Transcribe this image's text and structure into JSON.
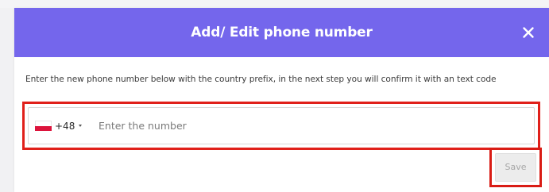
{
  "modal": {
    "title": "Add/ Edit phone number",
    "description": "Enter the new phone number below with the country prefix, in the next step you will confirm it with an text code"
  },
  "phone": {
    "country_flag": "poland-flag-icon",
    "country_code": "+48",
    "placeholder": "Enter the number",
    "value": ""
  },
  "actions": {
    "save_label": "Save"
  },
  "colors": {
    "header": "#7466ec",
    "highlight": "#e0201a",
    "save_disabled_bg": "#ececec",
    "save_disabled_text": "#a6a6a6"
  }
}
